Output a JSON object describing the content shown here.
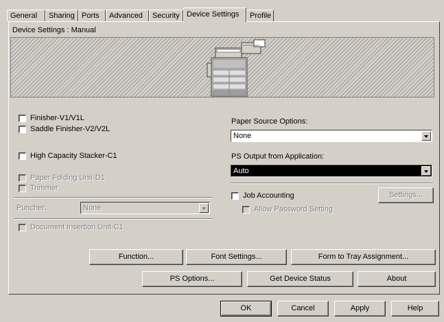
{
  "tabs": [
    {
      "label": "General"
    },
    {
      "label": "Sharing"
    },
    {
      "label": "Ports"
    },
    {
      "label": "Advanced"
    },
    {
      "label": "Security"
    },
    {
      "label": "Device Settings"
    },
    {
      "label": "Profile"
    }
  ],
  "active_tab": "Device Settings",
  "device_header": "Device Settings : Manual",
  "options": {
    "finisher_v1": "Finisher-V1/V1L",
    "saddle_finisher": "Saddle Finisher-V2/V2L",
    "high_capacity": "High Capacity Stacker-C1",
    "paper_folding": "Paper Folding Unit-D1",
    "trimmer": "Trimmer",
    "puncher_label": "Puncher:",
    "puncher_value": "None",
    "doc_insertion": "Document Insertion Unit-C1"
  },
  "right": {
    "paper_source_label": "Paper Source Options:",
    "paper_source_value": "None",
    "ps_output_label": "PS Output from Application:",
    "ps_output_value": "Auto",
    "job_accounting": "Job Accounting",
    "settings_button": "Settings...",
    "allow_password": "Allow Password Setting"
  },
  "buttons": {
    "function": "Function...",
    "font_settings": "Font Settings...",
    "form_to_tray": "Form to Tray Assignment...",
    "ps_options": "PS Options...",
    "get_device_status": "Get Device Status",
    "about": "About"
  },
  "dialog": {
    "ok": "OK",
    "cancel": "Cancel",
    "apply": "Apply",
    "help": "Help"
  },
  "colors": {
    "face": "#d4d0c8",
    "highlight": "#000000"
  }
}
